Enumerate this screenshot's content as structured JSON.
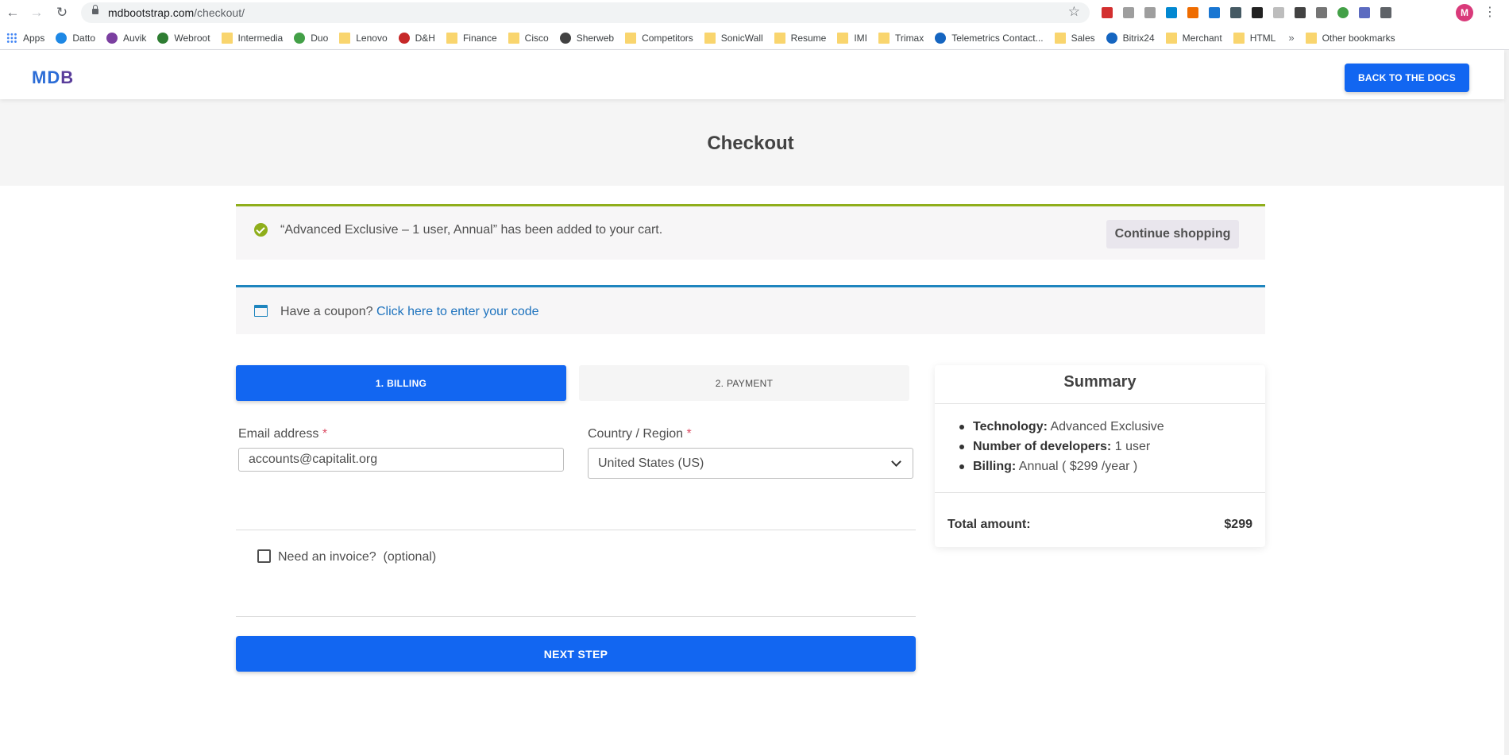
{
  "browser": {
    "url_host": "mdbootstrap.com",
    "url_path": "/checkout/",
    "avatar_letter": "M",
    "bookmarks": [
      {
        "label": "Apps",
        "icon": "apps-grid-icon",
        "color": "#4285f4"
      },
      {
        "label": "Datto",
        "icon": "datto-icon",
        "color": "#1e88e5"
      },
      {
        "label": "Auvik",
        "icon": "auvik-icon",
        "color": "#7b3fa0"
      },
      {
        "label": "Webroot",
        "icon": "webroot-icon",
        "color": "#2e7d32"
      },
      {
        "label": "Intermedia",
        "icon": "folder-icon",
        "color": "#f9d56e"
      },
      {
        "label": "Duo",
        "icon": "duo-icon",
        "color": "#43a047"
      },
      {
        "label": "Lenovo",
        "icon": "folder-icon",
        "color": "#f9d56e"
      },
      {
        "label": "D&H",
        "icon": "dh-icon",
        "color": "#c62828"
      },
      {
        "label": "Finance",
        "icon": "folder-icon",
        "color": "#f9d56e"
      },
      {
        "label": "Cisco",
        "icon": "folder-icon",
        "color": "#f9d56e"
      },
      {
        "label": "Sherweb",
        "icon": "sherweb-icon",
        "color": "#424242"
      },
      {
        "label": "Competitors",
        "icon": "folder-icon",
        "color": "#f9d56e"
      },
      {
        "label": "SonicWall",
        "icon": "folder-icon",
        "color": "#f9d56e"
      },
      {
        "label": "Resume",
        "icon": "folder-icon",
        "color": "#f9d56e"
      },
      {
        "label": "IMI",
        "icon": "folder-icon",
        "color": "#f9d56e"
      },
      {
        "label": "Trimax",
        "icon": "folder-icon",
        "color": "#f9d56e"
      },
      {
        "label": "Telemetrics Contact...",
        "icon": "telemetrics-icon",
        "color": "#1565c0"
      },
      {
        "label": "Sales",
        "icon": "folder-icon",
        "color": "#f9d56e"
      },
      {
        "label": "Bitrix24",
        "icon": "bitrix24-icon",
        "color": "#1565c0"
      },
      {
        "label": "Merchant",
        "icon": "folder-icon",
        "color": "#f9d56e"
      },
      {
        "label": "HTML",
        "icon": "folder-icon",
        "color": "#f9d56e"
      }
    ],
    "more_bookmarks": "»",
    "other_bookmarks": "Other bookmarks"
  },
  "navbar": {
    "logo_md": "MD",
    "logo_b": "B",
    "back_button": "BACK TO THE DOCS"
  },
  "hero": {
    "title": "Checkout"
  },
  "cart_notice": {
    "message": "“Advanced Exclusive – 1 user, Annual” has been added to your cart.",
    "continue_label": "Continue shopping"
  },
  "coupon_notice": {
    "prompt": "Have a coupon?",
    "link": "Click here to enter your code"
  },
  "steps": {
    "billing": "1. BILLING",
    "payment": "2. PAYMENT"
  },
  "form": {
    "email_label": "Email address",
    "email_value": "accounts@capitalit.org",
    "country_label": "Country / Region",
    "country_value": "United States (US)",
    "required_mark": "*",
    "invoice_label": "Need an invoice?",
    "invoice_optional": "(optional)",
    "invoice_checked": false,
    "next_button": "NEXT STEP"
  },
  "summary": {
    "title": "Summary",
    "items": [
      {
        "key": "Technology:",
        "value": "Advanced Exclusive"
      },
      {
        "key": "Number of developers:",
        "value": "1 user"
      },
      {
        "key": "Billing:",
        "value": "Annual ( $299 /year )"
      }
    ],
    "total_label": "Total amount:",
    "total_value": "$299"
  },
  "colors": {
    "primary": "#1266f1",
    "success_bar": "#8fae1b",
    "info_bar": "#1e85be",
    "link": "#1e73be"
  }
}
